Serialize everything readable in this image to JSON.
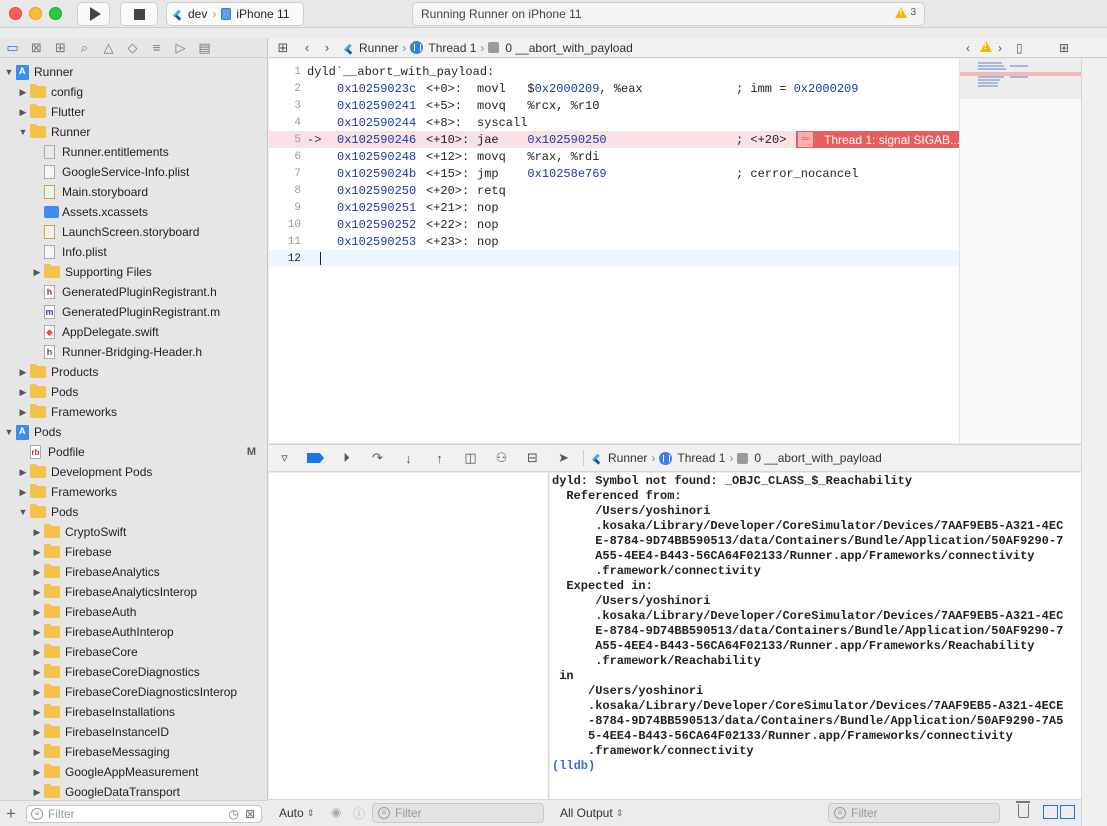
{
  "toolbar": {
    "scheme": "dev",
    "device": "iPhone 11",
    "activity": "Running Runner on iPhone 11",
    "warning_count": "3"
  },
  "navigator": {
    "filter_placeholder": "Filter",
    "tree": [
      {
        "label": "Runner",
        "kind": "project",
        "depth": 0,
        "open": true
      },
      {
        "label": "config",
        "kind": "folder",
        "depth": 1,
        "open": false
      },
      {
        "label": "Flutter",
        "kind": "folder",
        "depth": 1,
        "open": false
      },
      {
        "label": "Runner",
        "kind": "folder",
        "depth": 1,
        "open": true
      },
      {
        "label": "Runner.entitlements",
        "kind": "ent",
        "depth": 2
      },
      {
        "label": "GoogleService-Info.plist",
        "kind": "plist",
        "depth": 2
      },
      {
        "label": "Main.storyboard",
        "kind": "sb",
        "depth": 2
      },
      {
        "label": "Assets.xcassets",
        "kind": "xcassets",
        "depth": 2
      },
      {
        "label": "LaunchScreen.storyboard",
        "kind": "sb",
        "depth": 2
      },
      {
        "label": "Info.plist",
        "kind": "plist",
        "depth": 2
      },
      {
        "label": "Supporting Files",
        "kind": "folder",
        "depth": 2,
        "open": false
      },
      {
        "label": "GeneratedPluginRegistrant.h",
        "kind": "h",
        "depth": 2
      },
      {
        "label": "GeneratedPluginRegistrant.m",
        "kind": "m",
        "depth": 2
      },
      {
        "label": "AppDelegate.swift",
        "kind": "swift",
        "depth": 2
      },
      {
        "label": "Runner-Bridging-Header.h",
        "kind": "h",
        "depth": 2
      },
      {
        "label": "Products",
        "kind": "folder",
        "depth": 1,
        "open": false
      },
      {
        "label": "Pods",
        "kind": "folder",
        "depth": 1,
        "open": false
      },
      {
        "label": "Frameworks",
        "kind": "folder",
        "depth": 1,
        "open": false
      },
      {
        "label": "Pods",
        "kind": "project",
        "depth": 0,
        "open": true
      },
      {
        "label": "Podfile",
        "kind": "rb",
        "depth": 1,
        "badge": "M"
      },
      {
        "label": "Development Pods",
        "kind": "folder",
        "depth": 1,
        "open": false
      },
      {
        "label": "Frameworks",
        "kind": "folder",
        "depth": 1,
        "open": false
      },
      {
        "label": "Pods",
        "kind": "folder",
        "depth": 1,
        "open": true
      },
      {
        "label": "CryptoSwift",
        "kind": "folder",
        "depth": 2,
        "open": false
      },
      {
        "label": "Firebase",
        "kind": "folder",
        "depth": 2,
        "open": false
      },
      {
        "label": "FirebaseAnalytics",
        "kind": "folder",
        "depth": 2,
        "open": false
      },
      {
        "label": "FirebaseAnalyticsInterop",
        "kind": "folder",
        "depth": 2,
        "open": false
      },
      {
        "label": "FirebaseAuth",
        "kind": "folder",
        "depth": 2,
        "open": false
      },
      {
        "label": "FirebaseAuthInterop",
        "kind": "folder",
        "depth": 2,
        "open": false
      },
      {
        "label": "FirebaseCore",
        "kind": "folder",
        "depth": 2,
        "open": false
      },
      {
        "label": "FirebaseCoreDiagnostics",
        "kind": "folder",
        "depth": 2,
        "open": false
      },
      {
        "label": "FirebaseCoreDiagnosticsInterop",
        "kind": "folder",
        "depth": 2,
        "open": false
      },
      {
        "label": "FirebaseInstallations",
        "kind": "folder",
        "depth": 2,
        "open": false
      },
      {
        "label": "FirebaseInstanceID",
        "kind": "folder",
        "depth": 2,
        "open": false
      },
      {
        "label": "FirebaseMessaging",
        "kind": "folder",
        "depth": 2,
        "open": false
      },
      {
        "label": "GoogleAppMeasurement",
        "kind": "folder",
        "depth": 2,
        "open": false
      },
      {
        "label": "GoogleDataTransport",
        "kind": "folder",
        "depth": 2,
        "open": false
      }
    ]
  },
  "jumpbar": {
    "target": "Runner",
    "thread": "Thread 1",
    "frame": "0 __abort_with_payload"
  },
  "editor": {
    "lines": [
      {
        "n": "1",
        "text": "dyld`__abort_with_payload:"
      },
      {
        "n": "2",
        "addr": "0x10259023c",
        "off": "<+0>:",
        "instr": "movl   $",
        "arg": "0x2000209",
        "rest": ", %eax",
        "cmt": "; imm = ",
        "cmtv": "0x2000209"
      },
      {
        "n": "3",
        "addr": "0x102590241",
        "off": "<+5>:",
        "instr": "movq   %rcx, %r10"
      },
      {
        "n": "4",
        "addr": "0x102590244",
        "off": "<+8>:",
        "instr": "syscall"
      },
      {
        "n": "5",
        "addr": "0x102590246",
        "off": "<+10>:",
        "instr": "jae    ",
        "arg": "0x102590250",
        "cmt": "; <+20>",
        "current": true
      },
      {
        "n": "6",
        "addr": "0x102590248",
        "off": "<+12>:",
        "instr": "movq   %rax, %rdi"
      },
      {
        "n": "7",
        "addr": "0x10259024b",
        "off": "<+15>:",
        "instr": "jmp    ",
        "arg": "0x10258e769",
        "cmt": "; cerror_nocancel"
      },
      {
        "n": "8",
        "addr": "0x102590250",
        "off": "<+20>:",
        "instr": "retq"
      },
      {
        "n": "9",
        "addr": "0x102590251",
        "off": "<+21>:",
        "instr": "nop"
      },
      {
        "n": "10",
        "addr": "0x102590252",
        "off": "<+22>:",
        "instr": "nop"
      },
      {
        "n": "11",
        "addr": "0x102590253",
        "off": "<+23>:",
        "instr": "nop"
      },
      {
        "n": "12",
        "text": ""
      }
    ],
    "current_arrow": "->",
    "error_annotation": "Thread 1: signal SIGAB..."
  },
  "debugbar": {
    "target": "Runner",
    "thread": "Thread 1",
    "frame": "0 __abort_with_payload"
  },
  "console": {
    "text": "dyld: Symbol not found: _OBJC_CLASS_$_Reachability\n  Referenced from:\n      /Users/yoshinori\n      .kosaka/Library/Developer/CoreSimulator/Devices/7AAF9EB5-A321-4EC\n      E-8784-9D74BB590513/data/Containers/Bundle/Application/50AF9290-7\n      A55-4EE4-B443-56CA64F02133/Runner.app/Frameworks/connectivity\n      .framework/connectivity\n  Expected in:\n      /Users/yoshinori\n      .kosaka/Library/Developer/CoreSimulator/Devices/7AAF9EB5-A321-4EC\n      E-8784-9D74BB590513/data/Containers/Bundle/Application/50AF9290-7\n      A55-4EE4-B443-56CA64F02133/Runner.app/Frameworks/Reachability\n      .framework/Reachability\n in\n     /Users/yoshinori\n     .kosaka/Library/Developer/CoreSimulator/Devices/7AAF9EB5-A321-4ECE\n     -8784-9D74BB590513/data/Containers/Bundle/Application/50AF9290-7A5\n     5-4EE4-B443-56CA64F02133/Runner.app/Frameworks/connectivity\n     .framework/connectivity",
    "prompt": "(lldb)"
  },
  "bottom": {
    "vars_scope": "Auto",
    "vars_filter_placeholder": "Filter",
    "console_scope": "All Output",
    "console_filter_placeholder": "Filter"
  }
}
